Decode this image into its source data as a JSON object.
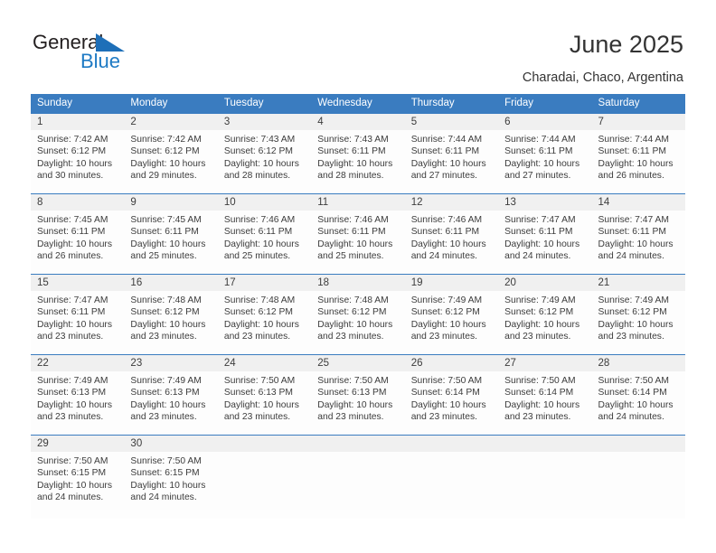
{
  "logo": {
    "word_general": "General",
    "word_blue": "Blue",
    "sail_icon": "triangle-sail-icon"
  },
  "header": {
    "title": "June 2025",
    "location": "Charadai, Chaco, Argentina"
  },
  "colors": {
    "header_blue": "#3a7cc0",
    "logo_blue": "#1e7ac4",
    "number_band": "#f0f0f0",
    "cell_bg": "#fdfdfd",
    "text": "#3c3c3c"
  },
  "calendar": {
    "weekday_headers": [
      "Sunday",
      "Monday",
      "Tuesday",
      "Wednesday",
      "Thursday",
      "Friday",
      "Saturday"
    ],
    "weeks": [
      {
        "days": [
          {
            "date": "1",
            "sunrise": "Sunrise: 7:42 AM",
            "sunset": "Sunset: 6:12 PM",
            "daylight": "Daylight: 10 hours and 30 minutes."
          },
          {
            "date": "2",
            "sunrise": "Sunrise: 7:42 AM",
            "sunset": "Sunset: 6:12 PM",
            "daylight": "Daylight: 10 hours and 29 minutes."
          },
          {
            "date": "3",
            "sunrise": "Sunrise: 7:43 AM",
            "sunset": "Sunset: 6:12 PM",
            "daylight": "Daylight: 10 hours and 28 minutes."
          },
          {
            "date": "4",
            "sunrise": "Sunrise: 7:43 AM",
            "sunset": "Sunset: 6:11 PM",
            "daylight": "Daylight: 10 hours and 28 minutes."
          },
          {
            "date": "5",
            "sunrise": "Sunrise: 7:44 AM",
            "sunset": "Sunset: 6:11 PM",
            "daylight": "Daylight: 10 hours and 27 minutes."
          },
          {
            "date": "6",
            "sunrise": "Sunrise: 7:44 AM",
            "sunset": "Sunset: 6:11 PM",
            "daylight": "Daylight: 10 hours and 27 minutes."
          },
          {
            "date": "7",
            "sunrise": "Sunrise: 7:44 AM",
            "sunset": "Sunset: 6:11 PM",
            "daylight": "Daylight: 10 hours and 26 minutes."
          }
        ]
      },
      {
        "days": [
          {
            "date": "8",
            "sunrise": "Sunrise: 7:45 AM",
            "sunset": "Sunset: 6:11 PM",
            "daylight": "Daylight: 10 hours and 26 minutes."
          },
          {
            "date": "9",
            "sunrise": "Sunrise: 7:45 AM",
            "sunset": "Sunset: 6:11 PM",
            "daylight": "Daylight: 10 hours and 25 minutes."
          },
          {
            "date": "10",
            "sunrise": "Sunrise: 7:46 AM",
            "sunset": "Sunset: 6:11 PM",
            "daylight": "Daylight: 10 hours and 25 minutes."
          },
          {
            "date": "11",
            "sunrise": "Sunrise: 7:46 AM",
            "sunset": "Sunset: 6:11 PM",
            "daylight": "Daylight: 10 hours and 25 minutes."
          },
          {
            "date": "12",
            "sunrise": "Sunrise: 7:46 AM",
            "sunset": "Sunset: 6:11 PM",
            "daylight": "Daylight: 10 hours and 24 minutes."
          },
          {
            "date": "13",
            "sunrise": "Sunrise: 7:47 AM",
            "sunset": "Sunset: 6:11 PM",
            "daylight": "Daylight: 10 hours and 24 minutes."
          },
          {
            "date": "14",
            "sunrise": "Sunrise: 7:47 AM",
            "sunset": "Sunset: 6:11 PM",
            "daylight": "Daylight: 10 hours and 24 minutes."
          }
        ]
      },
      {
        "days": [
          {
            "date": "15",
            "sunrise": "Sunrise: 7:47 AM",
            "sunset": "Sunset: 6:11 PM",
            "daylight": "Daylight: 10 hours and 23 minutes."
          },
          {
            "date": "16",
            "sunrise": "Sunrise: 7:48 AM",
            "sunset": "Sunset: 6:12 PM",
            "daylight": "Daylight: 10 hours and 23 minutes."
          },
          {
            "date": "17",
            "sunrise": "Sunrise: 7:48 AM",
            "sunset": "Sunset: 6:12 PM",
            "daylight": "Daylight: 10 hours and 23 minutes."
          },
          {
            "date": "18",
            "sunrise": "Sunrise: 7:48 AM",
            "sunset": "Sunset: 6:12 PM",
            "daylight": "Daylight: 10 hours and 23 minutes."
          },
          {
            "date": "19",
            "sunrise": "Sunrise: 7:49 AM",
            "sunset": "Sunset: 6:12 PM",
            "daylight": "Daylight: 10 hours and 23 minutes."
          },
          {
            "date": "20",
            "sunrise": "Sunrise: 7:49 AM",
            "sunset": "Sunset: 6:12 PM",
            "daylight": "Daylight: 10 hours and 23 minutes."
          },
          {
            "date": "21",
            "sunrise": "Sunrise: 7:49 AM",
            "sunset": "Sunset: 6:12 PM",
            "daylight": "Daylight: 10 hours and 23 minutes."
          }
        ]
      },
      {
        "days": [
          {
            "date": "22",
            "sunrise": "Sunrise: 7:49 AM",
            "sunset": "Sunset: 6:13 PM",
            "daylight": "Daylight: 10 hours and 23 minutes."
          },
          {
            "date": "23",
            "sunrise": "Sunrise: 7:49 AM",
            "sunset": "Sunset: 6:13 PM",
            "daylight": "Daylight: 10 hours and 23 minutes."
          },
          {
            "date": "24",
            "sunrise": "Sunrise: 7:50 AM",
            "sunset": "Sunset: 6:13 PM",
            "daylight": "Daylight: 10 hours and 23 minutes."
          },
          {
            "date": "25",
            "sunrise": "Sunrise: 7:50 AM",
            "sunset": "Sunset: 6:13 PM",
            "daylight": "Daylight: 10 hours and 23 minutes."
          },
          {
            "date": "26",
            "sunrise": "Sunrise: 7:50 AM",
            "sunset": "Sunset: 6:14 PM",
            "daylight": "Daylight: 10 hours and 23 minutes."
          },
          {
            "date": "27",
            "sunrise": "Sunrise: 7:50 AM",
            "sunset": "Sunset: 6:14 PM",
            "daylight": "Daylight: 10 hours and 23 minutes."
          },
          {
            "date": "28",
            "sunrise": "Sunrise: 7:50 AM",
            "sunset": "Sunset: 6:14 PM",
            "daylight": "Daylight: 10 hours and 24 minutes."
          }
        ]
      },
      {
        "days": [
          {
            "date": "29",
            "sunrise": "Sunrise: 7:50 AM",
            "sunset": "Sunset: 6:15 PM",
            "daylight": "Daylight: 10 hours and 24 minutes."
          },
          {
            "date": "30",
            "sunrise": "Sunrise: 7:50 AM",
            "sunset": "Sunset: 6:15 PM",
            "daylight": "Daylight: 10 hours and 24 minutes."
          },
          {
            "date": "",
            "sunrise": "",
            "sunset": "",
            "daylight": ""
          },
          {
            "date": "",
            "sunrise": "",
            "sunset": "",
            "daylight": ""
          },
          {
            "date": "",
            "sunrise": "",
            "sunset": "",
            "daylight": ""
          },
          {
            "date": "",
            "sunrise": "",
            "sunset": "",
            "daylight": ""
          },
          {
            "date": "",
            "sunrise": "",
            "sunset": "",
            "daylight": ""
          }
        ]
      }
    ]
  }
}
